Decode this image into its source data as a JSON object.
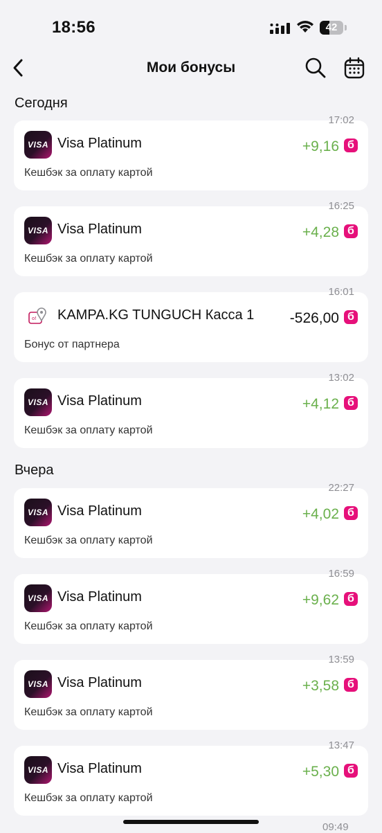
{
  "status_bar": {
    "time": "18:56",
    "battery": "42",
    "battery_level": 0.42
  },
  "header": {
    "title": "Мои бонусы"
  },
  "colors": {
    "accent": "#e6107a",
    "positive": "#6ab04c",
    "background": "#f3f3f6"
  },
  "icons": {
    "back": "chevron-left-icon",
    "search": "search-icon",
    "calendar": "calendar-icon",
    "visa": "visa-card-icon",
    "partner": "partner-location-icon"
  },
  "sections": [
    {
      "title": "Сегодня",
      "items": [
        {
          "time": "17:02",
          "title": "Visa Platinum",
          "subtitle": "Кешбэк за оплату картой",
          "amount": "+9,16",
          "currency": "б",
          "icon": "visa"
        },
        {
          "time": "16:25",
          "title": "Visa Platinum",
          "subtitle": "Кешбэк за оплату картой",
          "amount": "+4,28",
          "currency": "б",
          "icon": "visa"
        },
        {
          "time": "16:01",
          "title": "KAMPA.KG TUNGUCH Касса 1",
          "subtitle": "Бонус от партнера",
          "amount": "-526,00",
          "currency": "б",
          "icon": "partner"
        },
        {
          "time": "13:02",
          "title": "Visa Platinum",
          "subtitle": "Кешбэк за оплату картой",
          "amount": "+4,12",
          "currency": "б",
          "icon": "visa"
        }
      ]
    },
    {
      "title": "Вчера",
      "items": [
        {
          "time": "22:27",
          "title": "Visa Platinum",
          "subtitle": "Кешбэк за оплату картой",
          "amount": "+4,02",
          "currency": "б",
          "icon": "visa"
        },
        {
          "time": "16:59",
          "title": "Visa Platinum",
          "subtitle": "Кешбэк за оплату картой",
          "amount": "+9,62",
          "currency": "б",
          "icon": "visa"
        },
        {
          "time": "13:59",
          "title": "Visa Platinum",
          "subtitle": "Кешбэк за оплату картой",
          "amount": "+3,58",
          "currency": "б",
          "icon": "visa"
        },
        {
          "time": "13:47",
          "title": "Visa Platinum",
          "subtitle": "Кешбэк за оплату картой",
          "amount": "+5,30",
          "currency": "б",
          "icon": "visa"
        }
      ]
    }
  ],
  "visa_label": "VISA",
  "next_time_partial": "09:49"
}
